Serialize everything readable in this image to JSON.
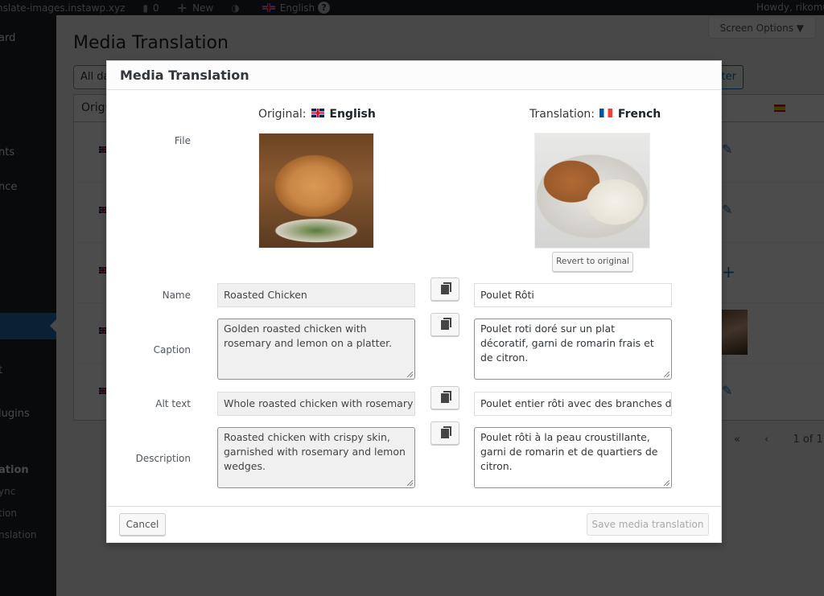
{
  "adminbar": {
    "site_name": "nslate-images.instawp.xyz",
    "comments_count": "0",
    "new_label": "New",
    "language_label": "English",
    "help_label": "?",
    "howdy": "Howdy, rikomu"
  },
  "sidebar": {
    "items": [
      {
        "label": "ard"
      },
      {
        "label": "nts"
      },
      {
        "label": "nce"
      },
      {
        "label": "t"
      },
      {
        "label": "lugins"
      }
    ],
    "submenu_title": "ation",
    "submenu_items": [
      {
        "label": "ync"
      },
      {
        "label": "tion"
      },
      {
        "label": "nslation"
      }
    ]
  },
  "page": {
    "title": "Media Translation",
    "screen_options": "Screen Options ▼",
    "date_filter": "All da",
    "filter_button": "ter",
    "table_header": "Origi",
    "pager": {
      "first": "«",
      "prev": "‹",
      "page_info": "1 of 1"
    }
  },
  "modal": {
    "title": "Media Translation",
    "original_prefix": "Original:",
    "original_language": "English",
    "translation_prefix": "Translation:",
    "translation_language": "French",
    "labels": {
      "file": "File",
      "name": "Name",
      "caption": "Caption",
      "alt_text": "Alt text",
      "description": "Description"
    },
    "original": {
      "name": "Roasted Chicken",
      "caption": "Golden roasted chicken with rosemary and lemon on a platter.",
      "alt_text": "Whole roasted chicken with rosemary and",
      "description": "Roasted chicken with crispy skin, garnished with rosemary and lemon wedges."
    },
    "translation": {
      "name": "Poulet Rôti",
      "caption": "Poulet roti doré sur un plat décoratif, garni de romarin frais et de citron.",
      "alt_text": "Poulet entier rôti avec des branches de romarin",
      "description": "Poulet rôti à la peau croustillante, garni de romarin et de quartiers de citron."
    },
    "revert_button": "Revert to original",
    "cancel_button": "Cancel",
    "save_button": "Save media translation"
  }
}
